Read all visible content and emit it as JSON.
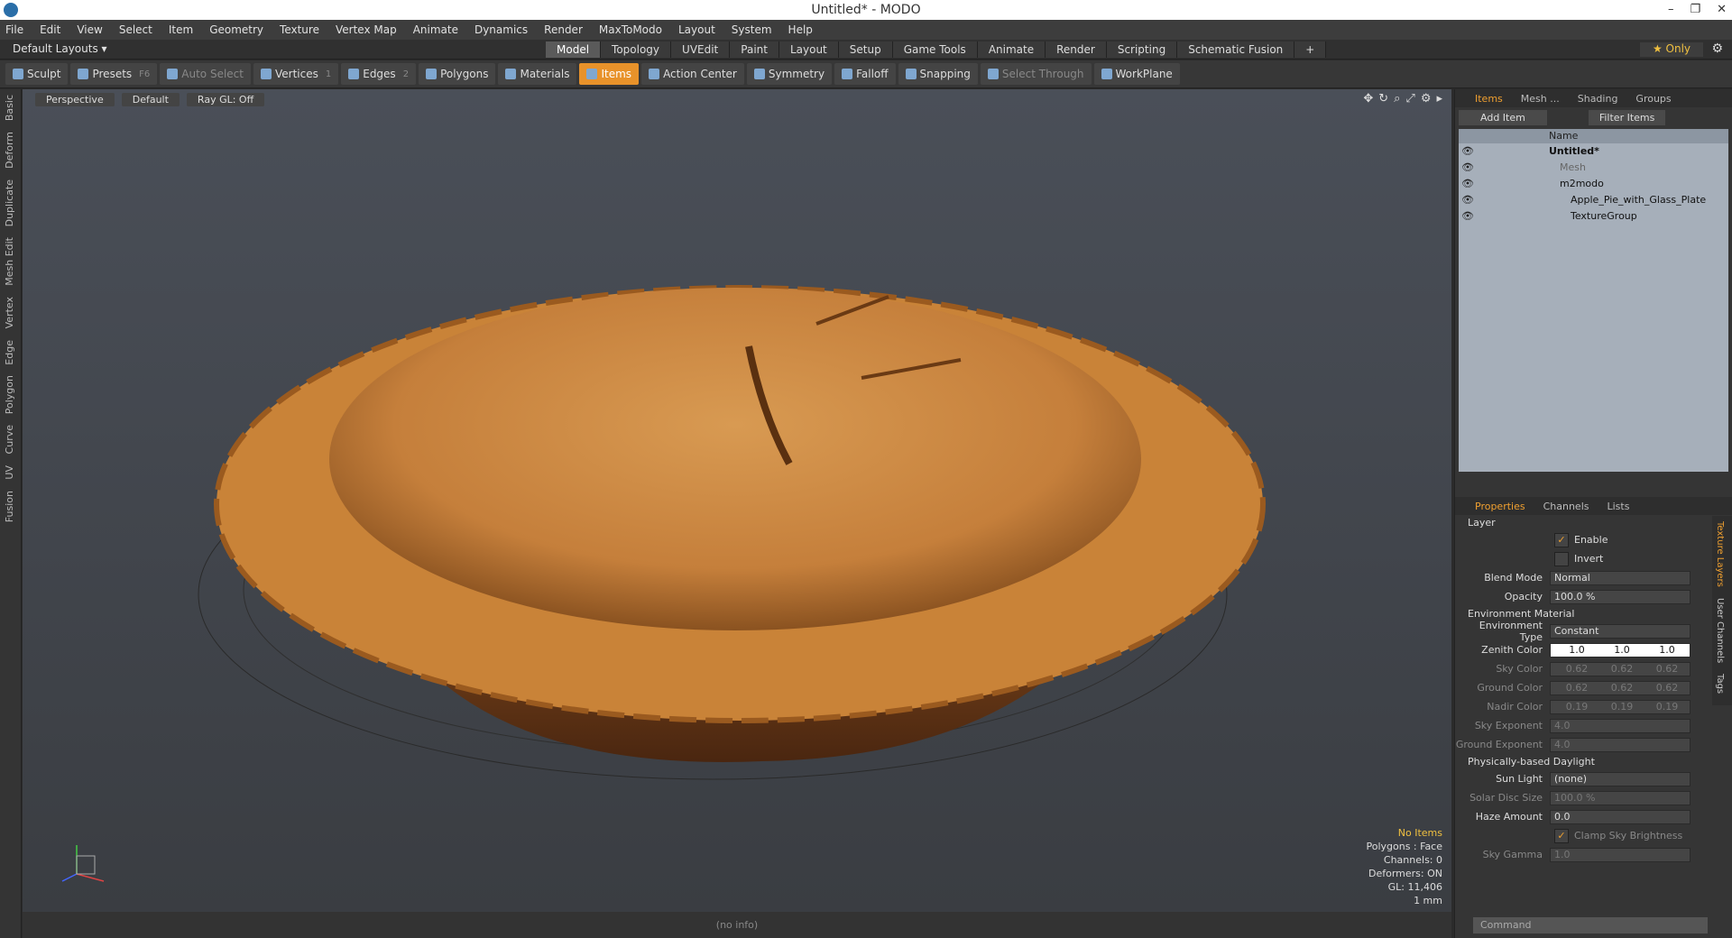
{
  "window": {
    "title": "Untitled* - MODO"
  },
  "menu": [
    "File",
    "Edit",
    "View",
    "Select",
    "Item",
    "Geometry",
    "Texture",
    "Vertex Map",
    "Animate",
    "Dynamics",
    "Render",
    "MaxToModo",
    "Layout",
    "System",
    "Help"
  ],
  "layout": {
    "selector": "Default Layouts",
    "tabs": [
      "Model",
      "Topology",
      "UVEdit",
      "Paint",
      "Layout",
      "Setup",
      "Game Tools",
      "Animate",
      "Render",
      "Scripting",
      "Schematic Fusion"
    ],
    "active_tab": "Model",
    "only_label": "Only"
  },
  "toolbar": {
    "items": [
      {
        "label": "Sculpt",
        "state": "normal"
      },
      {
        "label": "Presets",
        "key": "F6",
        "state": "normal"
      },
      {
        "label": "Auto Select",
        "state": "dim"
      },
      {
        "label": "Vertices",
        "key": "1",
        "state": "normal"
      },
      {
        "label": "Edges",
        "key": "2",
        "state": "normal"
      },
      {
        "label": "Polygons",
        "state": "normal"
      },
      {
        "label": "Materials",
        "state": "normal"
      },
      {
        "label": "Items",
        "state": "active"
      },
      {
        "label": "Action Center",
        "state": "normal"
      },
      {
        "label": "Symmetry",
        "state": "normal"
      },
      {
        "label": "Falloff",
        "state": "normal"
      },
      {
        "label": "Snapping",
        "state": "normal"
      },
      {
        "label": "Select Through",
        "state": "dim"
      },
      {
        "label": "WorkPlane",
        "state": "normal"
      }
    ]
  },
  "left_tabs": [
    "Basic",
    "Deform",
    "Duplicate",
    "Mesh Edit",
    "Vertex",
    "Edge",
    "Polygon",
    "Curve",
    "UV",
    "Fusion"
  ],
  "viewport": {
    "view": "Perspective",
    "shading": "Default",
    "raygl": "Ray GL: Off",
    "info": {
      "no_items": "No Items",
      "polygons": "Polygons : Face",
      "channels": "Channels: 0",
      "deformers": "Deformers: ON",
      "gl": "GL: 11,406",
      "unit": "1 mm"
    },
    "status": "(no info)"
  },
  "items_panel": {
    "tabs": [
      "Items",
      "Mesh ...",
      "Shading",
      "Groups"
    ],
    "add_item": "Add Item",
    "filter": "Filter Items",
    "col_name": "Name",
    "tree": [
      "Untitled*",
      "Mesh",
      "m2modo",
      "Apple_Pie_with_Glass_Plate",
      "TextureGroup"
    ]
  },
  "properties": {
    "tabs": [
      "Properties",
      "Channels",
      "Lists"
    ],
    "section_layer": "Layer",
    "enable": "Enable",
    "invert": "Invert",
    "blend_mode_label": "Blend Mode",
    "blend_mode": "Normal",
    "opacity_label": "Opacity",
    "opacity": "100.0 %",
    "section_env": "Environment Material",
    "env_type_label": "Environment Type",
    "env_type": "Constant",
    "zenith_label": "Zenith Color",
    "zenith": [
      "1.0",
      "1.0",
      "1.0"
    ],
    "sky_label": "Sky Color",
    "sky": [
      "0.62",
      "0.62",
      "0.62"
    ],
    "ground_label": "Ground Color",
    "ground": [
      "0.62",
      "0.62",
      "0.62"
    ],
    "nadir_label": "Nadir Color",
    "nadir": [
      "0.19",
      "0.19",
      "0.19"
    ],
    "sky_exp_label": "Sky Exponent",
    "sky_exp": "4.0",
    "ground_exp_label": "Ground Exponent",
    "ground_exp": "4.0",
    "section_daylight": "Physically-based Daylight",
    "sun_label": "Sun Light",
    "sun": "(none)",
    "solar_label": "Solar Disc Size",
    "solar": "100.0 %",
    "haze_label": "Haze Amount",
    "haze": "0.0",
    "clamp": "Clamp Sky Brightness",
    "gamma_label": "Sky Gamma",
    "gamma": "1.0"
  },
  "right_tabs": [
    "Texture Layers",
    "User Channels",
    "Tags"
  ],
  "command": "Command"
}
